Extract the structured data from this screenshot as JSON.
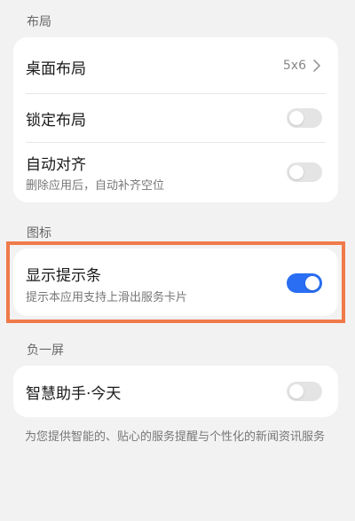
{
  "sections": {
    "layout_label": "布局",
    "icon_label": "图标",
    "minus_one_label": "负一屏"
  },
  "layout_card": {
    "desktop_layout": {
      "title": "桌面布局",
      "value": "5x6"
    },
    "lock_layout": {
      "title": "锁定布局",
      "enabled": false
    },
    "auto_align": {
      "title": "自动对齐",
      "subtitle": "删除应用后，自动补齐空位",
      "enabled": false
    }
  },
  "icon_card": {
    "show_hint_bar": {
      "title": "显示提示条",
      "subtitle": "提示本应用支持上滑出服务卡片",
      "enabled": true
    }
  },
  "minus_one_card": {
    "smart_assistant": {
      "title": "智慧助手·今天",
      "enabled": false
    }
  },
  "footer": {
    "description": "为您提供智能的、贴心的服务提醒与个性化的新闻资讯服务"
  },
  "colors": {
    "accent": "#2a6ef3",
    "highlight": "#f07a4a",
    "background": "#f2f2f2"
  }
}
